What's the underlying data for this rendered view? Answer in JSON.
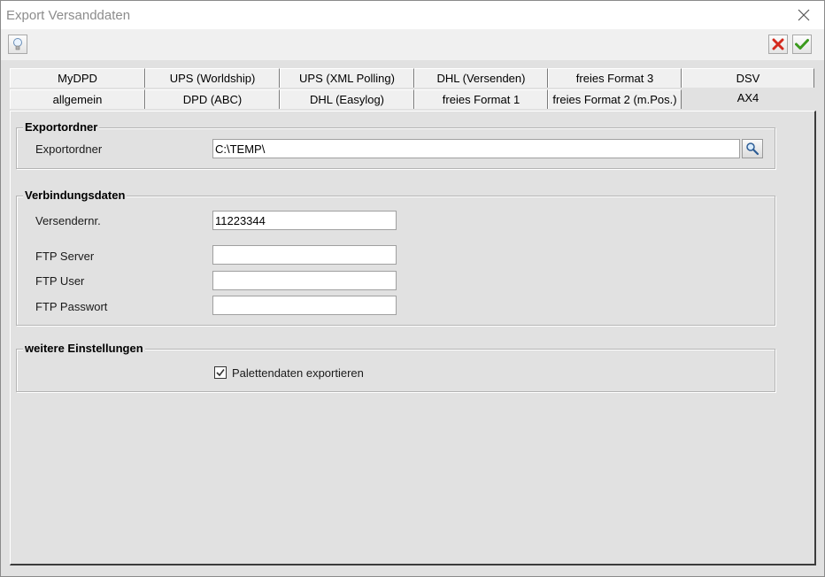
{
  "window": {
    "title": "Export Versanddaten"
  },
  "toolbar": {
    "hint_icon": "lightbulb-icon",
    "cancel_icon": "red-x-icon",
    "ok_icon": "green-check-icon"
  },
  "tabs": {
    "row1": [
      "MyDPD",
      "UPS (Worldship)",
      "UPS (XML Polling)",
      "DHL (Versenden)",
      "freies Format 3",
      "DSV"
    ],
    "row2": [
      "allgemein",
      "DPD (ABC)",
      "DHL (Easylog)",
      "freies Format 1",
      "freies Format 2 (m.Pos.)",
      "AX4"
    ],
    "active": "AX4"
  },
  "export": {
    "group_title": "Exportordner",
    "folder_label": "Exportordner",
    "folder_value": "C:\\TEMP\\"
  },
  "connection": {
    "group_title": "Verbindungsdaten",
    "sender_label": "Versendernr.",
    "sender_value": "11223344",
    "ftp_server_label": "FTP Server",
    "ftp_server_value": "",
    "ftp_user_label": "FTP User",
    "ftp_user_value": "",
    "ftp_password_label": "FTP Passwort",
    "ftp_password_value": ""
  },
  "settings": {
    "group_title": "weitere Einstellungen",
    "pallet_label": "Palettendaten exportieren",
    "pallet_checked": true
  }
}
